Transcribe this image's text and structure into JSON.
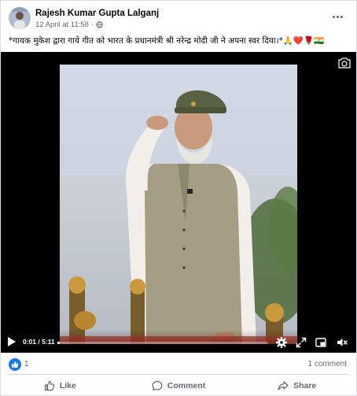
{
  "post": {
    "author": "Rajesh Kumar Gupta Lalganj",
    "timestamp": "12 April at 11:58",
    "separator": "·",
    "audience_icon": "globe-icon",
    "caption": "*गायक मुकेश द्वारा गाये गीत को भारत के प्रधानमंत्री श्री नरेन्द्र मोदी जी ने अपना स्वर दिया।*🙏❤️🌹🇮🇳"
  },
  "video": {
    "current_time": "0:01",
    "duration": "5:11",
    "time_display": "0:01 / 5:11",
    "progress": 0.0032,
    "icons": [
      "camera-icon",
      "play-icon",
      "settings-icon",
      "expand-icon",
      "pip-icon",
      "volume-muted-icon"
    ]
  },
  "stats": {
    "likes": "1",
    "comments": "1 comment"
  },
  "actions": {
    "like": "Like",
    "comment": "Comment",
    "share": "Share"
  },
  "colors": {
    "accent": "#1877f2",
    "secondary_text": "#65676b",
    "video_bg": "#000000"
  }
}
